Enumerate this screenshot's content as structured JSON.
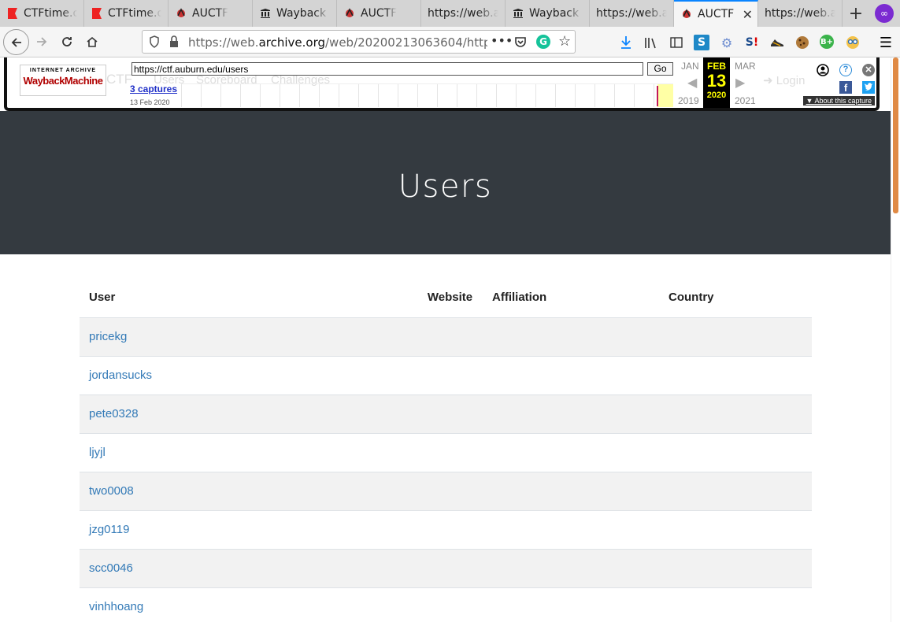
{
  "browser": {
    "tabs": [
      {
        "title": "CTFtime.org",
        "icon": "ctftime-flag-icon",
        "active": false
      },
      {
        "title": "CTFtime.org",
        "icon": "ctftime-flag-icon",
        "active": false
      },
      {
        "title": "AUCTF",
        "icon": "auctf-logo-icon",
        "active": false
      },
      {
        "title": "Wayback Machine",
        "icon": "archive-building-icon",
        "active": false
      },
      {
        "title": "AUCTF",
        "icon": "auctf-logo-icon",
        "active": false
      },
      {
        "title": "https://web.archive.org",
        "icon": "",
        "active": false
      },
      {
        "title": "Wayback Machine",
        "icon": "archive-building-icon",
        "active": false
      },
      {
        "title": "https://web.archive.org",
        "icon": "",
        "active": false
      },
      {
        "title": "AUCTF",
        "icon": "auctf-logo-icon",
        "active": true
      },
      {
        "title": "https://web.archive.org",
        "icon": "",
        "active": false
      }
    ],
    "url_prefix": "https://web.",
    "url_domain": "archive.org",
    "url_rest": "/web/20200213063604/http"
  },
  "wayback": {
    "url_value": "https://ctf.auburn.edu/users",
    "go_label": "Go",
    "captures_label": "3 captures",
    "capture_date": "13 Feb 2020",
    "prev_month": "JAN",
    "cur_month": "FEB",
    "next_month": "MAR",
    "cur_day": "13",
    "prev_year": "2019",
    "cur_year": "2020",
    "next_year": "2021",
    "about_label": "About this capture",
    "logo_top": "INTERNET ARCHIVE",
    "logo_bottom": "WaybackMachine"
  },
  "site_nav": {
    "brand": "CTF",
    "links": [
      "Users",
      "Scoreboard",
      "Challenges"
    ],
    "login": "Login"
  },
  "page": {
    "title": "Users"
  },
  "table": {
    "headers": [
      "User",
      "Website",
      "Affiliation",
      "Country"
    ],
    "rows": [
      "pricekg",
      "jordansucks",
      "pete0328",
      "ljyjl",
      "two0008",
      "jzg0119",
      "scc0046",
      "vinhhoang"
    ]
  }
}
